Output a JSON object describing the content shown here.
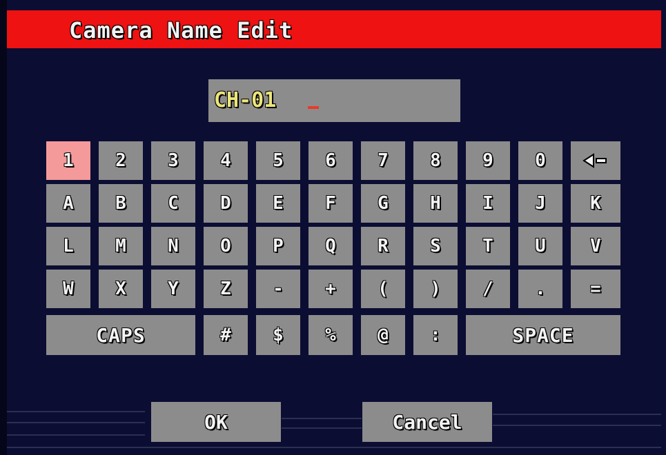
{
  "window": {
    "title": "Camera Name Edit"
  },
  "name_field": {
    "value": "CH-01"
  },
  "keyboard": {
    "rows": [
      [
        "1",
        "2",
        "3",
        "4",
        "5",
        "6",
        "7",
        "8",
        "9",
        "0"
      ],
      [
        "A",
        "B",
        "C",
        "D",
        "E",
        "F",
        "G",
        "H",
        "I",
        "J",
        "K"
      ],
      [
        "L",
        "M",
        "N",
        "O",
        "P",
        "Q",
        "R",
        "S",
        "T",
        "U",
        "V"
      ],
      [
        "W",
        "X",
        "Y",
        "Z",
        "-",
        "+",
        "(",
        ")",
        "/",
        ".",
        "="
      ]
    ],
    "bottom_row": {
      "caps": "CAPS",
      "symbols": [
        "#",
        "$",
        "%",
        "@",
        ":"
      ],
      "space": "SPACE"
    },
    "backspace_icon": "backspace-arrow-icon",
    "selected_key": "1"
  },
  "buttons": {
    "ok": "OK",
    "cancel": "Cancel"
  },
  "colors": {
    "background": "#0b0d33",
    "title_bar": "#ee1212",
    "key": "#8c8c8c",
    "key_selected": "#f59a9a",
    "name_text": "#ece57a"
  }
}
